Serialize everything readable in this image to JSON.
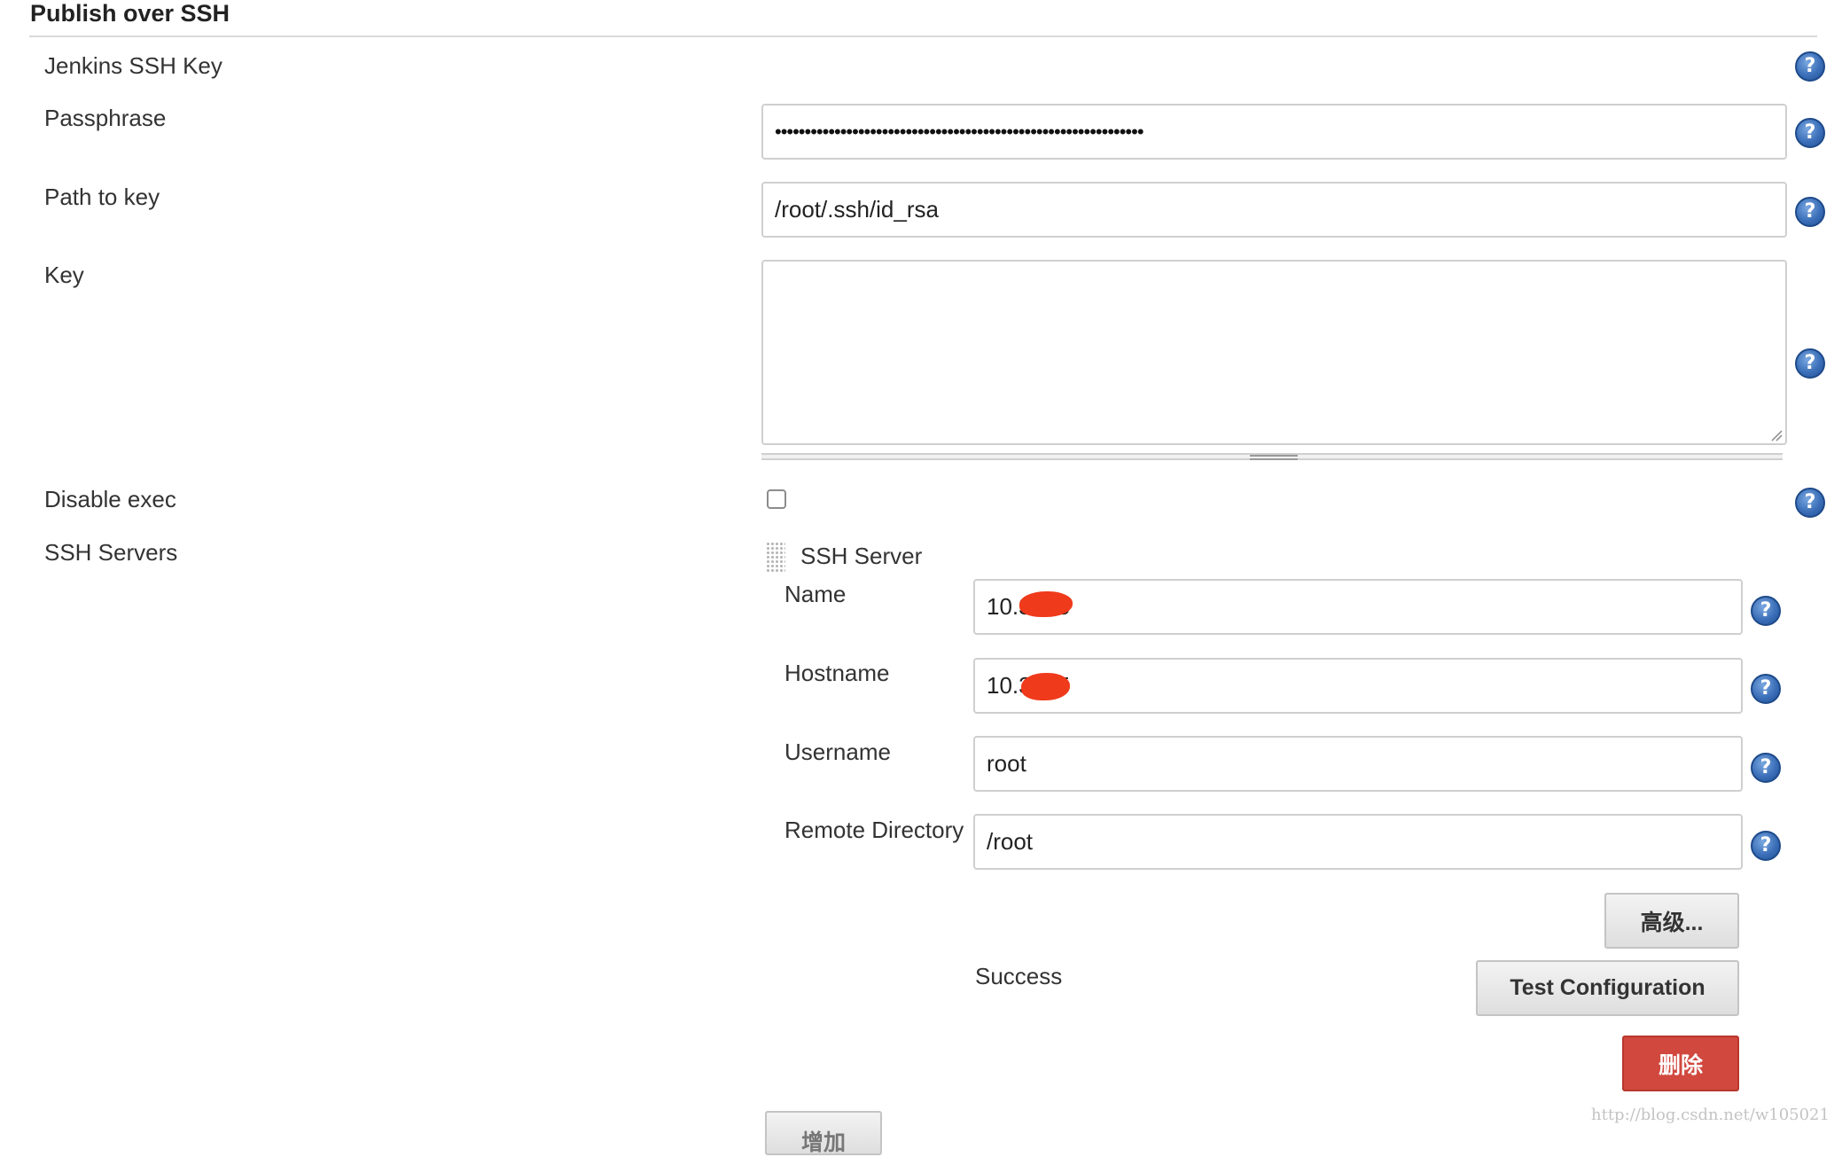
{
  "section": {
    "title": "Publish over SSH"
  },
  "fields": {
    "jenkins_ssh_key": {
      "label": "Jenkins SSH Key"
    },
    "passphrase": {
      "label": "Passphrase",
      "value": "••••••••••••••••••••••••••••••••••••••••••••••••••••••••••••••"
    },
    "path_to_key": {
      "label": "Path to key",
      "value": "/root/.ssh/id_rsa"
    },
    "key": {
      "label": "Key",
      "value": ""
    },
    "disable_exec": {
      "label": "Disable exec",
      "checked": false
    },
    "ssh_servers": {
      "label": "SSH Servers"
    }
  },
  "server": {
    "header": "SSH Server",
    "name": {
      "label": "Name",
      "value": "10.3 .25"
    },
    "hostname": {
      "label": "Hostname",
      "value": "10.3 .25"
    },
    "username": {
      "label": "Username",
      "value": "root"
    },
    "remote_directory": {
      "label": "Remote Directory",
      "value": "/root"
    },
    "advanced_button": "高级...",
    "status_text": "Success",
    "test_button": "Test Configuration",
    "delete_button": "删除"
  },
  "add_button": "增加",
  "help_icon_glyph": "?",
  "watermark": "http://blog.csdn.net/w105021",
  "colors": {
    "help_icon": "#3b6fb8",
    "delete_button": "#d1483e",
    "redaction": "#f03a1c"
  }
}
